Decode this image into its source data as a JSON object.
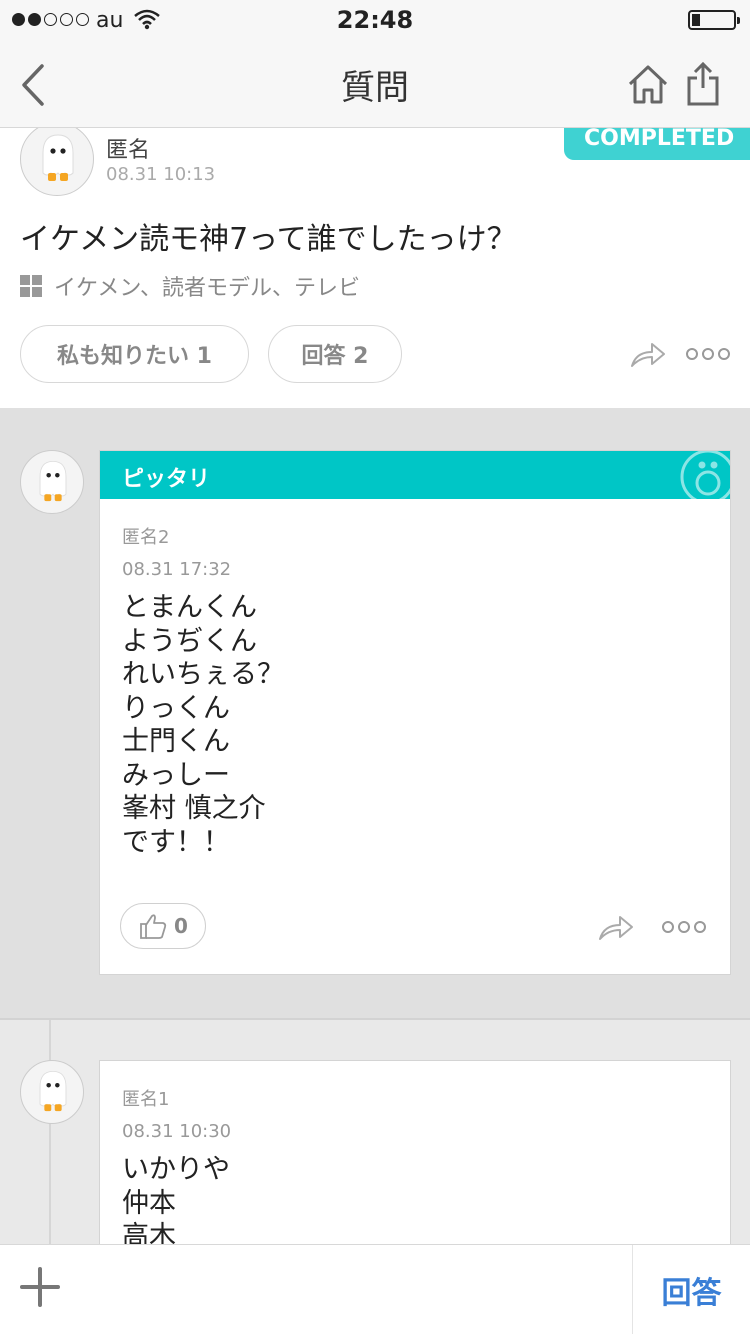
{
  "status_bar": {
    "carrier": "au",
    "time": "22:48",
    "signal_bars": 2,
    "signal_total": 5,
    "battery_level": 0.2
  },
  "nav": {
    "title": "質問",
    "back_icon": "chevron-left-icon",
    "home_icon": "home-icon",
    "share_icon": "share-icon"
  },
  "question": {
    "author": "匿名",
    "date": "08.31 10:13",
    "badge": "COMPLETED",
    "title": "イケメン読モ神7って誰でしたっけ？",
    "tags": "イケメン、読者モデル、テレビ",
    "want_to_know_label": "私も知りたい 1",
    "answers_label": "回答 2"
  },
  "best_answer": {
    "header": "ピッタリ",
    "author": "匿名2",
    "date": "08.31 17:32",
    "lines": [
      "とまんくん",
      "ようぢくん",
      "れいちぇる？",
      "りっくん",
      "士門くん",
      "みっしー",
      "峯村 慎之介",
      "です！！"
    ],
    "likes": "0"
  },
  "answer": {
    "author": "匿名1",
    "date": "08.31 10:30",
    "lines": [
      "いかりや",
      "仲本",
      "高木"
    ]
  },
  "bottom_bar": {
    "add_icon": "plus-icon",
    "answer_label": "回答"
  },
  "colors": {
    "accent_teal": "#00c6c6",
    "completed_teal": "#3fd2d2",
    "link_blue": "#3a7fd6"
  }
}
